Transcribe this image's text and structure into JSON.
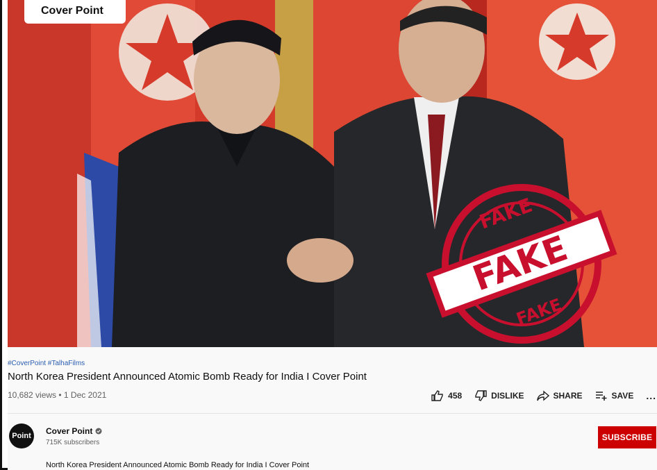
{
  "video": {
    "overlay_label": "Cover Point",
    "stamp": {
      "top": "FAKE",
      "middle": "FAKE",
      "bottom": "FAKE"
    },
    "colors": {
      "stamp": "#c8102e",
      "flag_red": "#d9372a"
    }
  },
  "info": {
    "hashtags": "#CoverPoint #TalhaFilms",
    "title": "North Korea President Announced Atomic Bomb Ready for India I Cover Point",
    "meta": "10,682 views • 1 Dec 2021"
  },
  "actions": {
    "like_count": "458",
    "dislike_label": "DISLIKE",
    "share_label": "SHARE",
    "save_label": "SAVE",
    "more_label": "..."
  },
  "channel": {
    "avatar_text": "Point",
    "name": "Cover Point",
    "subscribers": "715K subscribers",
    "subscribe_label": "SUBSCRIBE",
    "description": "North Korea President Announced Atomic Bomb Ready for India I Cover Point"
  }
}
